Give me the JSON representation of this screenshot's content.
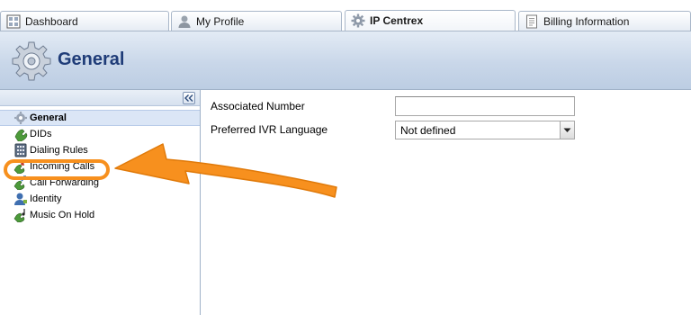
{
  "tabs": [
    {
      "label": "Dashboard",
      "icon": "dashboard-icon"
    },
    {
      "label": "My Profile",
      "icon": "user-icon"
    },
    {
      "label": "IP Centrex",
      "icon": "gear-icon",
      "active": true
    },
    {
      "label": "Billing Information",
      "icon": "document-icon"
    }
  ],
  "header": {
    "title": "General",
    "icon": "gear-icon"
  },
  "sidebar": {
    "items": [
      {
        "label": "General",
        "icon": "gear-icon",
        "selected": true
      },
      {
        "label": "DIDs",
        "icon": "dids-icon"
      },
      {
        "label": "Dialing Rules",
        "icon": "dialpad-icon"
      },
      {
        "label": "Incoming Calls",
        "icon": "incoming-calls-icon"
      },
      {
        "label": "Call Forwarding",
        "icon": "call-forwarding-icon"
      },
      {
        "label": "Identity",
        "icon": "identity-icon"
      },
      {
        "label": "Music On Hold",
        "icon": "music-on-hold-icon"
      }
    ]
  },
  "form": {
    "associated_number_label": "Associated Number",
    "associated_number_value": "",
    "ivr_language_label": "Preferred IVR Language",
    "ivr_language_value": "Not defined"
  },
  "annotation": {
    "highlighted_item": "Incoming Calls",
    "color": "#f7901e"
  }
}
